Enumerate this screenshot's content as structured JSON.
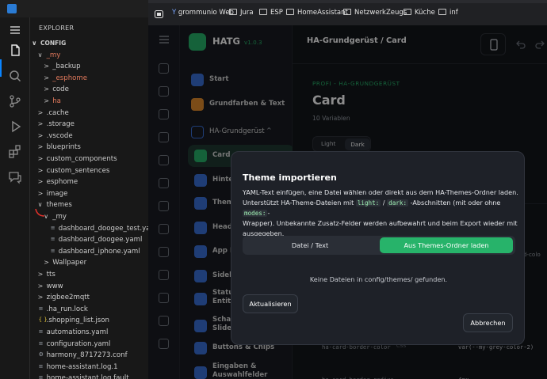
{
  "vscode": {
    "explorer_title": "EXPLORER",
    "tree": [
      {
        "label": "CONFIG",
        "chev": "∨",
        "indent": 0,
        "head": true
      },
      {
        "label": "_my",
        "chev": "∨",
        "indent": 1,
        "orange": true
      },
      {
        "label": "_backup",
        "chev": ">",
        "indent": 2
      },
      {
        "label": "_esphome",
        "chev": ">",
        "indent": 2,
        "orange": true
      },
      {
        "label": "code",
        "chev": ">",
        "indent": 2
      },
      {
        "label": "ha",
        "chev": ">",
        "indent": 2,
        "orange": true
      },
      {
        "label": ".cache",
        "chev": ">",
        "indent": 1
      },
      {
        "label": ".storage",
        "chev": ">",
        "indent": 1
      },
      {
        "label": ".vscode",
        "chev": ">",
        "indent": 1
      },
      {
        "label": "blueprints",
        "chev": ">",
        "indent": 1
      },
      {
        "label": "custom_components",
        "chev": ">",
        "indent": 1
      },
      {
        "label": "custom_sentences",
        "chev": ">",
        "indent": 1
      },
      {
        "label": "esphome",
        "chev": ">",
        "indent": 1
      },
      {
        "label": "image",
        "chev": ">",
        "indent": 1
      },
      {
        "label": "themes",
        "chev": "∨",
        "indent": 1
      },
      {
        "label": "_my",
        "chev": "∨",
        "indent": 2
      },
      {
        "label": "dashboard_doogee_test.yaml",
        "chev": "",
        "indent": 3,
        "file": true
      },
      {
        "label": "dashboard_doogee.yaml",
        "chev": "",
        "indent": 3,
        "file": true
      },
      {
        "label": "dashboard_iphone.yaml",
        "chev": "",
        "indent": 3,
        "file": true
      },
      {
        "label": "Wallpaper",
        "chev": ">",
        "indent": 2
      },
      {
        "label": "tts",
        "chev": ">",
        "indent": 1
      },
      {
        "label": "www",
        "chev": ">",
        "indent": 1
      },
      {
        "label": "zigbee2mqtt",
        "chev": ">",
        "indent": 1
      },
      {
        "label": ".ha_run.lock",
        "chev": "",
        "indent": 1,
        "file": true
      },
      {
        "label": ".shopping_list.json",
        "chev": "",
        "indent": 1,
        "file": true,
        "icon": "{ }"
      },
      {
        "label": "automations.yaml",
        "chev": "",
        "indent": 1,
        "file": true
      },
      {
        "label": "configuration.yaml",
        "chev": "",
        "indent": 1,
        "file": true
      },
      {
        "label": "harmony_8717273.conf",
        "chev": "",
        "indent": 1,
        "file": true,
        "icon": "⚙"
      },
      {
        "label": "home-assistant.log.1",
        "chev": "",
        "indent": 1,
        "file": true
      },
      {
        "label": "home-assistant.log.fault",
        "chev": "",
        "indent": 1,
        "file": true
      }
    ]
  },
  "browser": {
    "bookmarks": [
      {
        "label": "grommunio Web",
        "type": "y"
      },
      {
        "label": "Jura",
        "type": "folder"
      },
      {
        "label": "ESP",
        "type": "folder"
      },
      {
        "label": "HomeAssistant",
        "type": "folder"
      },
      {
        "label": "NetzwerkZeugs",
        "type": "folder"
      },
      {
        "label": "Küche",
        "type": "folder"
      },
      {
        "label": "inf",
        "type": "folder"
      }
    ]
  },
  "hatg": {
    "app_name": "HATG",
    "version": "v1.0.3",
    "page_title": "HA-Grundgerüst / Card",
    "section_kicker": "PROFI - HA-GRUNDGERÜST",
    "heading": "Card",
    "var_count": "10 Variablen",
    "mode_light": "Light",
    "mode_dark": "Dark",
    "nav": [
      {
        "label": "Start",
        "color": "#3a6fd8",
        "type": "item"
      },
      {
        "label": "Grundfarben & Text",
        "color": "#e08a2c",
        "type": "item"
      },
      {
        "label": "HA-Grundgerüst",
        "color": "#3a6fd8",
        "type": "group"
      },
      {
        "label": "Card",
        "color": "#27b36a",
        "type": "active"
      },
      {
        "label": "Hinte",
        "color": "#3a6fd8",
        "type": "sub"
      },
      {
        "label": "Them",
        "color": "#3a6fd8",
        "type": "sub"
      },
      {
        "label": "Head",
        "color": "#3a6fd8",
        "type": "sub"
      },
      {
        "label": "App I",
        "color": "#3a6fd8",
        "type": "sub"
      },
      {
        "label": "Sideb",
        "color": "#3a6fd8",
        "type": "sub"
      },
      {
        "label": "Status",
        "label2": "Entitä",
        "color": "#3a6fd8",
        "type": "sub"
      },
      {
        "label": "Schal",
        "label2": "Slider",
        "color": "#3a6fd8",
        "type": "sub"
      },
      {
        "label": "Buttons & Chips",
        "color": "#3a6fd8",
        "type": "sub"
      },
      {
        "label": "Eingaben &",
        "label2": "Auswahlfelder",
        "color": "#3a6fd8",
        "type": "sub"
      }
    ],
    "var_rows": [
      {
        "name": "ha-card-border-color",
        "tag": "CSS",
        "value": "var(--my-grey-color-2)"
      },
      {
        "name": "ha-card-border-radius",
        "tag": "",
        "value": "4px"
      }
    ],
    "partial_right": "rd-colo"
  },
  "modal": {
    "title": "Theme importieren",
    "text_1": "YAML-Text einfügen, eine Datei wählen oder direkt aus dem HA-Themes-Ordner laden.",
    "text_2a": "Unterstützt HA-Theme-Dateien mit",
    "code_light": "light:",
    "text_slash": " / ",
    "code_dark": "dark:",
    "text_2b": "-Abschnitten (mit oder ohne",
    "code_modes": "modes:",
    "text_2c": "-",
    "text_3": "Wrapper). Unbekannte Zusatz-Felder werden aufbewahrt und beim Export wieder mit",
    "text_4": "ausgegeben.",
    "tab_file": "Datei / Text",
    "tab_folder": "Aus Themes-Ordner laden",
    "empty_msg": "Keine Dateien in config/themes/ gefunden.",
    "refresh": "Aktualisieren",
    "cancel": "Abbrechen"
  }
}
